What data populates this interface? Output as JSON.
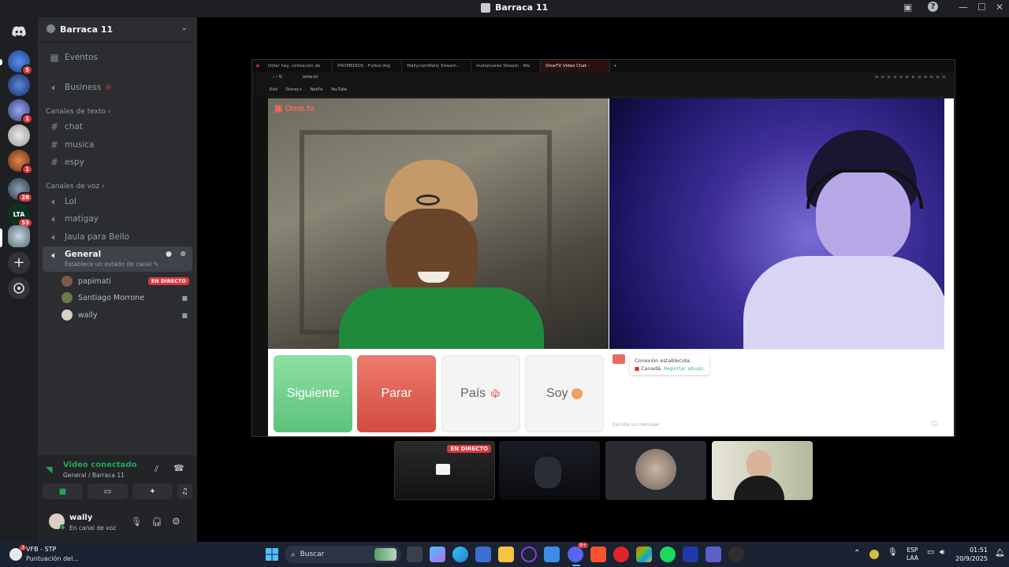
{
  "window": {
    "title": "Barraca 11"
  },
  "guilds": [
    {
      "badge": "5",
      "color": "#3a6fd1"
    },
    {
      "badge": "",
      "color": "#2f5ea8"
    },
    {
      "badge": "1",
      "color": "#6b7acb"
    },
    {
      "badge": "",
      "color": "#c9c9c9"
    },
    {
      "badge": "1",
      "color": "#c0642a"
    },
    {
      "badge": "28",
      "color": "#4a5b6a"
    },
    {
      "badge": "53",
      "color": "#0f4f2a"
    },
    {
      "badge": "",
      "color": "#7a8f9c"
    }
  ],
  "guild_text": {
    "lta": "LTA"
  },
  "server": {
    "name": "Barraca 11"
  },
  "channels": {
    "events": "Eventos",
    "business": "Business",
    "text_category": "Canales de texto",
    "text": [
      "chat",
      "musica",
      "espy"
    ],
    "voice_category": "Canales de voz",
    "voice": [
      "Lol",
      "matigay",
      "Jaula para Bello"
    ],
    "active": {
      "name": "General",
      "status": "Establece un estado de canal"
    }
  },
  "voice_users": [
    {
      "name": "papimati",
      "badge": "EN DIRECTO"
    },
    {
      "name": "Santiago Morrone",
      "badge": ""
    },
    {
      "name": "wally",
      "badge": ""
    }
  ],
  "voice_panel": {
    "status": "Video conectado",
    "location": "General / Barraca 11"
  },
  "user": {
    "name": "wally",
    "status": "En canal de voz"
  },
  "stream": {
    "tabs": [
      "Dólar hoy, cotización de",
      "PROMEDIOS - Futbol Arg",
      "WallycomWally Stream - ",
      "matialvarez Stream - Wa",
      "OmeTV Video Chat - "
    ],
    "url": "ome.tv",
    "bookmarks": [
      "Kick",
      "Disney+",
      "Netflix",
      "YouTube"
    ],
    "logo": "Ome.tv",
    "buttons": {
      "next": "Siguiente",
      "stop": "Parar",
      "country": "País",
      "me": "Soy"
    },
    "chat": {
      "line1": "Conexión establecida.",
      "country": "Canadá.",
      "report": "Reportar abuso.",
      "placeholder": "Escribe un mensaje"
    }
  },
  "tiles": {
    "live_badge": "EN DIRECTO"
  },
  "taskbar": {
    "weather_badge": "3",
    "weather_title": "VFB - STP",
    "weather_sub": "Puntuación del...",
    "search_placeholder": "Buscar",
    "discord_badge": "9+",
    "lang1": "ESP",
    "lang2": "LAA",
    "time": "01:51",
    "date": "20/9/2025"
  },
  "colors": {
    "accent_green": "#23a55a",
    "live_red": "#da373c",
    "next_green": "#6dd08a",
    "stop_red": "#e25a4e"
  }
}
